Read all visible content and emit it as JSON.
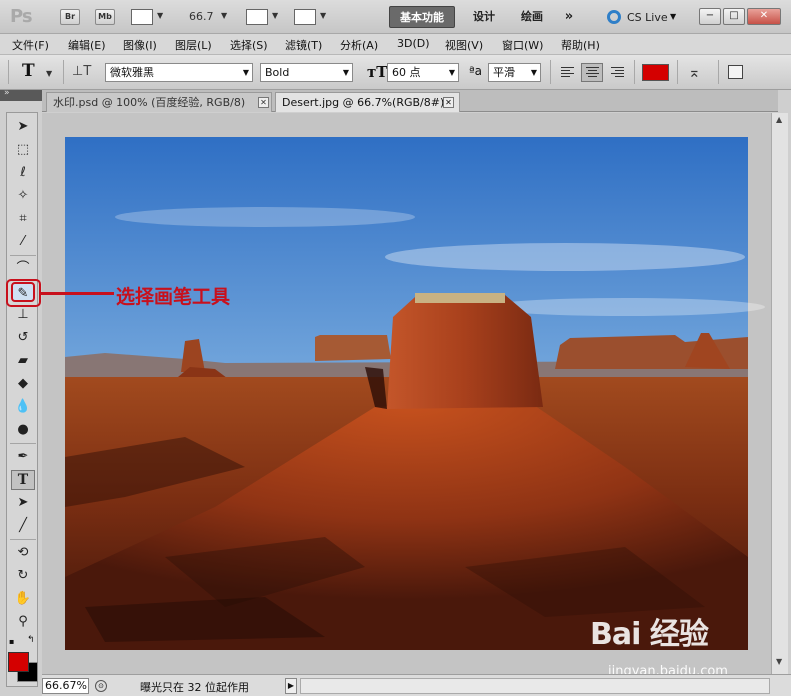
{
  "app": {
    "logo_text": "Ps",
    "bridge_label": "Br",
    "minibridge_label": "Mb",
    "zoom_value": "66.7"
  },
  "workspaces": {
    "essentials": "基本功能",
    "design": "设计",
    "painting": "绘画",
    "more": "»"
  },
  "cs_live": {
    "label": "CS Live"
  },
  "window_controls": {
    "minimize": "−",
    "maximize": "□",
    "close": "✕"
  },
  "menu": {
    "items": [
      "文件(F)",
      "编辑(E)",
      "图像(I)",
      "图层(L)",
      "选择(S)",
      "滤镜(T)",
      "分析(A)",
      "3D(D)",
      "视图(V)",
      "窗口(W)",
      "帮助(H)"
    ]
  },
  "options": {
    "tool_glyph": "T",
    "font_family": "微软雅黑",
    "font_style": "Bold",
    "font_size": "60 点",
    "aa_glyph": "ªa",
    "anti_alias": "平滑",
    "text_color": "#d40000"
  },
  "tabs": [
    {
      "title": "水印.psd @ 100% (百度经验, RGB/8)",
      "close": "✕"
    },
    {
      "title": "Desert.jpg @ 66.7%(RGB/8#)",
      "close": "✕"
    }
  ],
  "tools": {
    "foreground_color": "#d40000",
    "background_color": "#000000",
    "highlighted": "brush-tool"
  },
  "status": {
    "zoom": "66.67%",
    "info": "曝光只在 32 位起作用",
    "arrow": "▶"
  },
  "annotation": {
    "text": "选择画笔工具",
    "color": "#c8101c"
  },
  "watermark": {
    "logo": "Bai 经验",
    "subtitle": "jingyan.baidu.com"
  }
}
